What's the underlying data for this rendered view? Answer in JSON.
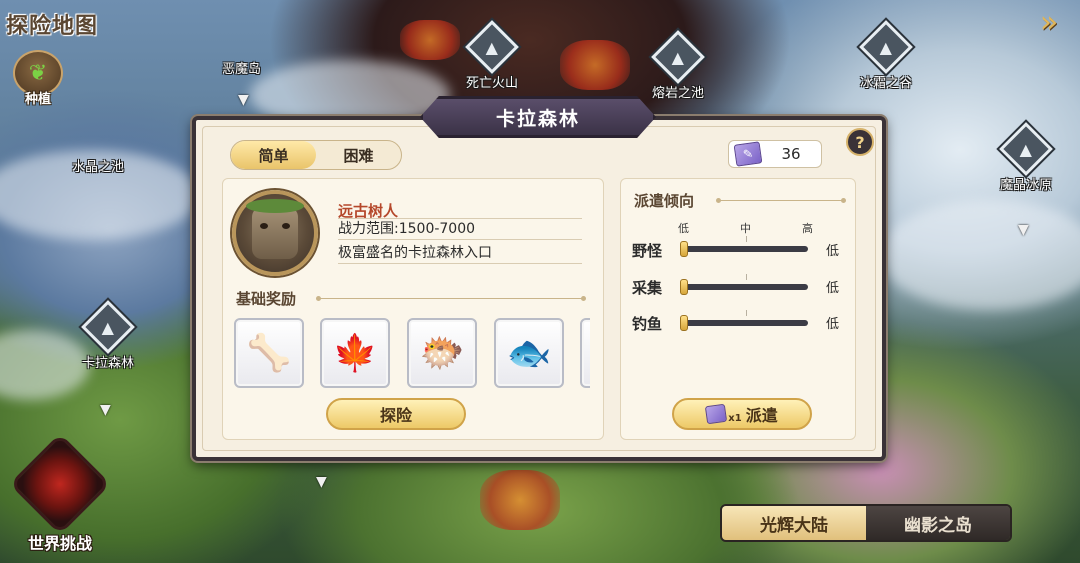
{
  "map": {
    "title": "探险地图",
    "plant_label": "种植",
    "world_challenge_label": "世界挑战",
    "locations": [
      {
        "name": "恶魔岛",
        "marker": false
      },
      {
        "name": "死亡火山",
        "marker": true
      },
      {
        "name": "熔岩之池",
        "marker": true
      },
      {
        "name": "冰霜之谷",
        "marker": true
      },
      {
        "name": "水晶之池",
        "marker": false
      },
      {
        "name": "魔晶冰原",
        "marker": true
      },
      {
        "name": "卡拉森林",
        "marker": true
      }
    ],
    "region_tabs": [
      {
        "label": "光辉大陆",
        "active": true
      },
      {
        "label": "幽影之岛",
        "active": false
      }
    ],
    "icons": {
      "exit": "exit-arrow-icon",
      "plant": "seedling-icon",
      "world": "crossed-swords-emblem-icon",
      "location": "mountain-marker-icon"
    }
  },
  "dialog": {
    "title": "卡拉森林",
    "help_label": "?",
    "difficulty_tabs": [
      {
        "label": "简单",
        "active": true
      },
      {
        "label": "困难",
        "active": false
      }
    ],
    "ticket": {
      "icon": "scroll-ticket-icon",
      "count": "36"
    },
    "boss": {
      "name": "远古树人",
      "power_range": "战力范围:1500-7000",
      "description": "极富盛名的卡拉森林入口",
      "icon": "treant-portrait-icon"
    },
    "rewards_title": "基础奖励",
    "rewards": [
      {
        "icon": "leather-hide-icon",
        "glyph": "🦴"
      },
      {
        "icon": "green-leaf-icon",
        "glyph": "🍁"
      },
      {
        "icon": "pufferfish-icon",
        "glyph": "🐡"
      },
      {
        "icon": "fish-icon",
        "glyph": "🐟"
      }
    ],
    "explore_label": "探险",
    "dispatch": {
      "title": "派遣倾向",
      "scale": [
        "低",
        "中",
        "高"
      ],
      "rows": [
        {
          "label": "野怪",
          "value": "低",
          "level": 0
        },
        {
          "label": "采集",
          "value": "低",
          "level": 0
        },
        {
          "label": "钓鱼",
          "value": "低",
          "level": 0
        }
      ],
      "button_label": "派遣",
      "cost_label": "x1"
    }
  },
  "colors": {
    "accent_gold": "#edc967",
    "dialog_bg": "#f6efe1",
    "title_bar": "#3b3247",
    "boss_name": "#b5482b"
  }
}
